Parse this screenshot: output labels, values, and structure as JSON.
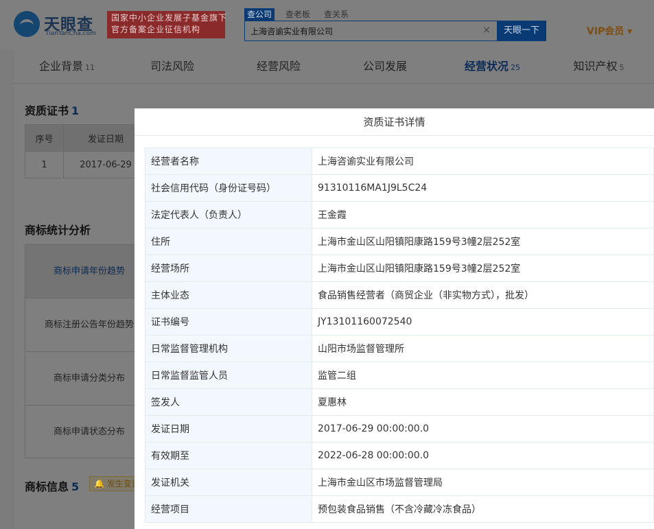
{
  "header": {
    "logo_cn": "天眼查",
    "logo_en": "TianYanCha.com",
    "slogan_line1": "国家中小企业发展子基金旗下",
    "slogan_line2": "官方备案企业征信机构",
    "search_tabs": [
      "查公司",
      "查老板",
      "查关系"
    ],
    "search_value": "上海咨谕实业有限公司",
    "search_clear": "×",
    "search_button": "天眼一下",
    "vip_label": "VIP会员 ▾"
  },
  "nav": {
    "items": [
      {
        "label": "企业背景",
        "count": "11"
      },
      {
        "label": "司法风险",
        "count": ""
      },
      {
        "label": "经营风险",
        "count": ""
      },
      {
        "label": "公司发展",
        "count": ""
      },
      {
        "label": "经营状况",
        "count": "25"
      },
      {
        "label": "知识产权",
        "count": "5"
      }
    ]
  },
  "qualification": {
    "title": "资质证书",
    "count": "1",
    "columns": [
      "序号",
      "发证日期"
    ],
    "rows": [
      [
        "1",
        "2017-06-29"
      ]
    ]
  },
  "trademark_stats": {
    "title": "商标统计分析",
    "rows": [
      "商标申请年份趋势",
      "商标注册公告年份趋势",
      "商标申请分类分布",
      "商标申请状态分布"
    ]
  },
  "trademark_info": {
    "title": "商标信息",
    "count": "5",
    "badge": "发生变更"
  },
  "modal": {
    "title": "资质证书详情",
    "rows": [
      {
        "key": "经营者名称",
        "value": "上海咨谕实业有限公司"
      },
      {
        "key": "社会信用代码（身份证号码）",
        "value": "91310116MA1J9L5C24"
      },
      {
        "key": "法定代表人（负责人）",
        "value": "王金霞"
      },
      {
        "key": "住所",
        "value": "上海市金山区山阳镇阳康路159号3幢2层252室"
      },
      {
        "key": "经营场所",
        "value": "上海市金山区山阳镇阳康路159号3幢2层252室"
      },
      {
        "key": "主体业态",
        "value": "食品销售经营者（商贸企业（非实物方式），批发）"
      },
      {
        "key": "证书编号",
        "value": "JY13101160072540"
      },
      {
        "key": "日常监督管理机构",
        "value": "山阳市场监督管理所"
      },
      {
        "key": "日常监督监管人员",
        "value": "监管二组"
      },
      {
        "key": "签发人",
        "value": "夏惠林"
      },
      {
        "key": "发证日期",
        "value": "2017-06-29 00:00:00.0"
      },
      {
        "key": "有效期至",
        "value": "2022-06-28 00:00:00.0"
      },
      {
        "key": "发证机关",
        "value": "上海市金山区市场监督管理局"
      },
      {
        "key": "经营项目",
        "value": "预包装食品销售（不含冷藏冷冻食品）"
      }
    ]
  }
}
